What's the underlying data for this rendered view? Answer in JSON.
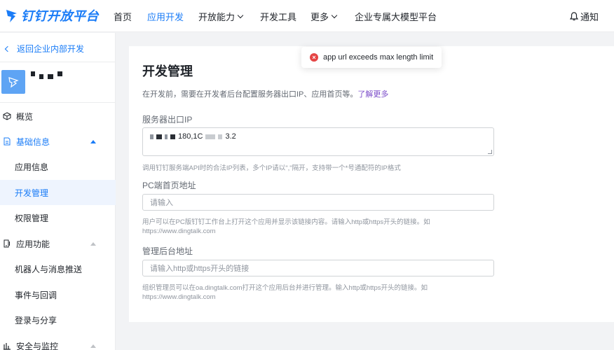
{
  "colors": {
    "brand": "#1a7cf7",
    "link_purple": "#7b4cc9",
    "error": "#e54545"
  },
  "topnav": {
    "logo_text": "钉钉开放平台",
    "items": [
      {
        "label": "首页"
      },
      {
        "label": "应用开发"
      },
      {
        "label": "开放能力"
      },
      {
        "label": "开发工具"
      },
      {
        "label": "更多"
      },
      {
        "label": "企业专属大模型平台"
      }
    ],
    "notify_label": "通知"
  },
  "sidebar": {
    "back_label": "返回企业内部开发",
    "groups": [
      {
        "label": "概览",
        "icon": "cube-icon"
      },
      {
        "label": "基础信息",
        "icon": "document-icon"
      },
      {
        "label": "应用功能",
        "icon": "app-function-icon"
      },
      {
        "label": "安全与监控",
        "icon": "bar-chart-icon"
      }
    ],
    "sub_items": [
      {
        "label": "应用信息"
      },
      {
        "label": "开发管理"
      },
      {
        "label": "权限管理"
      },
      {
        "label": "机器人与消息推送"
      },
      {
        "label": "事件与回调"
      },
      {
        "label": "登录与分享"
      }
    ]
  },
  "main": {
    "title": "开发管理",
    "desc": "在开发前，需要在开发者后台配置服务器出口IP、应用首页等。",
    "desc_link": "了解更多",
    "server_ip": {
      "label": "服务器出口IP",
      "value_visible_1": "180,1C",
      "value_visible_2": "3.2",
      "help": "调用钉钉服务端API时的合法IP列表，多个IP请以\",\"隔开，支持带一个*号通配符的IP格式"
    },
    "pc_home": {
      "label": "PC端首页地址",
      "placeholder": "请输入",
      "help_line1": "用户可以在PC版钉钉工作台上打开这个应用并显示该链接内容。请输入http或https开头的链接。如",
      "help_line2": "https://www.dingtalk.com"
    },
    "admin_url": {
      "label": "管理后台地址",
      "placeholder": "请输入http或https开头的链接",
      "help_line1": "组织管理员可以在oa.dingtalk.com打开这个应用后台并进行管理。输入http或https开头的链接。如",
      "help_line2": "https://www.dingtalk.com"
    }
  },
  "toast": {
    "message": "app url exceeds max length limit",
    "icon": "error-icon"
  }
}
